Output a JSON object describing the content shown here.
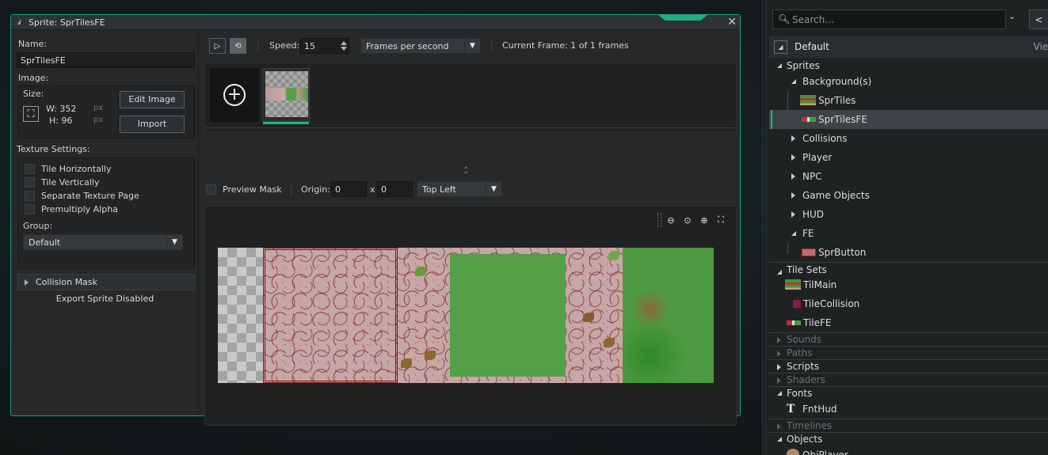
{
  "window": {
    "title": "Sprite: SprTilesFE",
    "close_label": "✕"
  },
  "left": {
    "name_label": "Name:",
    "name_value": "SprTilesFE",
    "image_label": "Image:",
    "size_label": "Size:",
    "width": "W: 352",
    "height": "H: 96",
    "unit_w": "px",
    "unit_h": "px",
    "edit_image": "Edit Image",
    "import": "Import",
    "texture_settings_label": "Texture Settings:",
    "checkboxes": [
      {
        "label": "Tile Horizontally",
        "checked": false
      },
      {
        "label": "Tile Vertically",
        "checked": false
      },
      {
        "label": "Separate Texture Page",
        "checked": false
      },
      {
        "label": "Premultiply Alpha",
        "checked": false
      }
    ],
    "group_label": "Group:",
    "group_value": "Default",
    "collision_mask": "Collision Mask",
    "export_note": "Export Sprite Disabled"
  },
  "toolbar": {
    "speed_label": "Speed:",
    "speed_value": "15",
    "speed_unit": "Frames per second",
    "current_frame": "Current Frame: 1 of 1 frames"
  },
  "mask": {
    "preview_mask": "Preview Mask",
    "origin_label": "Origin:",
    "origin_x": "0",
    "x_sep": "x",
    "origin_y": "0",
    "origin_mode": "Top Left"
  },
  "tree": {
    "search_placeholder": "Search...",
    "header_title": "Default",
    "header_view": "View",
    "rows": [
      {
        "label": "Sprites"
      },
      {
        "label": "Background(s)"
      },
      {
        "label": "SprTiles"
      },
      {
        "label": "SprTilesFE"
      },
      {
        "label": "Collisions"
      },
      {
        "label": "Player"
      },
      {
        "label": "NPC"
      },
      {
        "label": "Game Objects"
      },
      {
        "label": "HUD"
      },
      {
        "label": "FE"
      },
      {
        "label": "SprButton"
      },
      {
        "label": "Tile Sets"
      },
      {
        "label": "TilMain"
      },
      {
        "label": "TileCollision"
      },
      {
        "label": "TileFE"
      },
      {
        "label": "Sounds"
      },
      {
        "label": "Paths"
      },
      {
        "label": "Scripts"
      },
      {
        "label": "Shaders"
      },
      {
        "label": "Fonts"
      },
      {
        "label": "FntHud"
      },
      {
        "label": "Timelines"
      },
      {
        "label": "Objects"
      },
      {
        "label": "ObjPlayer"
      }
    ]
  },
  "colors": {
    "accent": "#1fb588",
    "window_border": "#18a07a"
  }
}
